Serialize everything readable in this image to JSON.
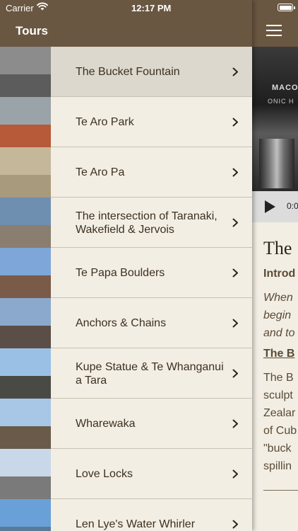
{
  "status": {
    "carrier": "Carrier",
    "time": "12:17 PM"
  },
  "nav": {
    "title": "Tours"
  },
  "tours": [
    {
      "label": "The Bucket Fountain",
      "selected": true,
      "c1": "#8c8c8c",
      "c2": "#5c5c5c"
    },
    {
      "label": "Te Aro Park",
      "selected": false,
      "c1": "#9aa3a8",
      "c2": "#b65a3a"
    },
    {
      "label": "Te Aro Pa",
      "selected": false,
      "c1": "#c5b89a",
      "c2": "#a89a7c"
    },
    {
      "label": "The intersection of Taranaki, Wakefield & Jervois",
      "selected": false,
      "c1": "#6f8fb0",
      "c2": "#8a7e70"
    },
    {
      "label": "Te Papa Boulders",
      "selected": false,
      "c1": "#7fa6d8",
      "c2": "#7a5a48"
    },
    {
      "label": "Anchors & Chains",
      "selected": false,
      "c1": "#8aa9cc",
      "c2": "#5a4e46"
    },
    {
      "label": "Kupe Statue & Te Whanganui a Tara",
      "selected": false,
      "c1": "#9bc0e6",
      "c2": "#4a4a44"
    },
    {
      "label": "Wharewaka",
      "selected": false,
      "c1": "#a8c6e6",
      "c2": "#6a5a4a"
    },
    {
      "label": "Love Locks",
      "selected": false,
      "c1": "#c8d8e8",
      "c2": "#7a7a7a"
    },
    {
      "label": "Len Lye's Water Whirler",
      "selected": false,
      "c1": "#6aa0d8",
      "c2": "#5a7a9a"
    }
  ],
  "detail": {
    "sign": "MACO",
    "sign2": "ONIC H",
    "audio_time": "0:0",
    "title": "The",
    "subheading": "Introd",
    "intro": "When\nbegin\nand to",
    "section_heading": "The B",
    "body": "The B\nsculpt\nZealar\nof Cub\n\"buck\nspillin"
  }
}
